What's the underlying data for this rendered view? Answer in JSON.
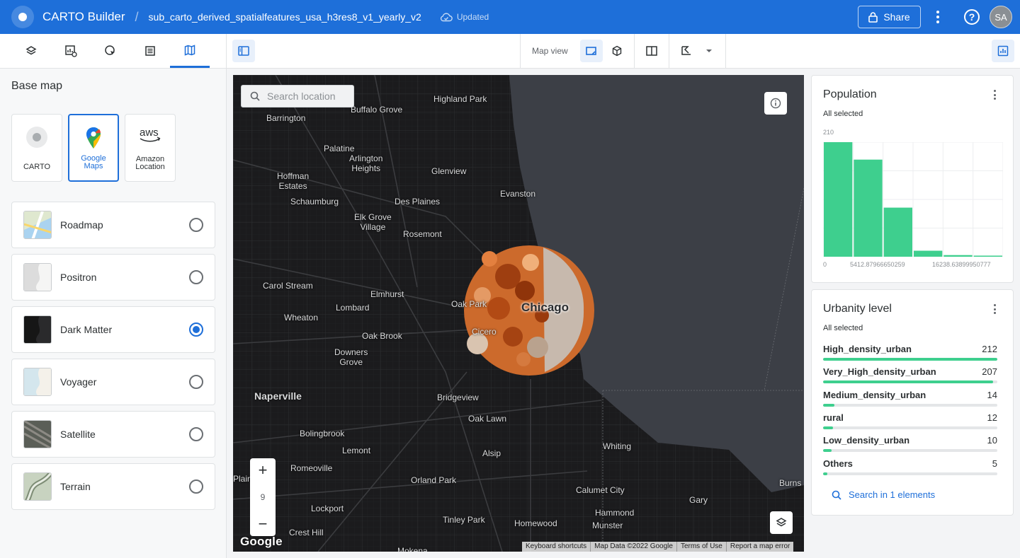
{
  "app": {
    "title": "CARTO Builder",
    "map_name": "sub_carto_derived_spatialfeatures_usa_h3res8_v1_yearly_v2",
    "save_status": "Updated",
    "share_label": "Share",
    "help_label": "?",
    "user_initials": "SA"
  },
  "toolbar": {
    "map_view_label": "Map view"
  },
  "basemap": {
    "title": "Base map",
    "providers": [
      {
        "label": "CARTO",
        "selected": false
      },
      {
        "label": "Google\nMaps",
        "selected": true
      },
      {
        "label": "Amazon\nLocation",
        "selected": false
      }
    ],
    "styles": [
      {
        "name": "Roadmap",
        "selected": false
      },
      {
        "name": "Positron",
        "selected": false
      },
      {
        "name": "Dark Matter",
        "selected": true
      },
      {
        "name": "Voyager",
        "selected": false
      },
      {
        "name": "Satellite",
        "selected": false
      },
      {
        "name": "Terrain",
        "selected": false
      }
    ]
  },
  "map": {
    "search_placeholder": "Search location",
    "zoom_level": "9",
    "google_logo": "Google",
    "attribution": [
      "Keyboard shortcuts",
      "Map Data ©2022 Google",
      "Terms of Use",
      "Report a map error"
    ],
    "labels": {
      "highland_park": "Highland Park",
      "buffalo_grove": "Buffalo Grove",
      "barrington": "Barrington",
      "palatine": "Palatine",
      "arlington_heights": "Arlington\nHeights",
      "glenview": "Glenview",
      "hoffman_estates": "Hoffman\nEstates",
      "evanston": "Evanston",
      "schaumburg": "Schaumburg",
      "des_plaines": "Des Plaines",
      "elk_grove": "Elk Grove\nVillage",
      "rosemont": "Rosemont",
      "carol_stream": "Carol Stream",
      "elmhurst": "Elmhurst",
      "lombard": "Lombard",
      "oak_park": "Oak Park",
      "chicago": "Chicago",
      "wheaton": "Wheaton",
      "cicero": "Cicero",
      "oak_brook": "Oak Brook",
      "downers_grove": "Downers\nGrove",
      "naperville": "Naperville",
      "bridgeview": "Bridgeview",
      "oak_lawn": "Oak Lawn",
      "bolingbrook": "Bolingbrook",
      "lemont": "Lemont",
      "alsip": "Alsip",
      "whiting": "Whiting",
      "romeoville": "Romeoville",
      "plainfield": "Plain",
      "orland_park": "Orland Park",
      "calumet_city": "Calumet City",
      "burns": "Burns",
      "gary": "Gary",
      "lockport": "Lockport",
      "hammond": "Hammond",
      "tinley_park": "Tinley Park",
      "homewood": "Homewood",
      "munster": "Munster",
      "crest_hill": "Crest Hill",
      "mokena": "Mokena"
    }
  },
  "widgets": {
    "population": {
      "title": "Population",
      "subtitle": "All selected",
      "y_max_label": "210",
      "x_labels": [
        "0",
        "5412.87966650259",
        "16238.63899950777"
      ]
    },
    "urbanity": {
      "title": "Urbanity level",
      "subtitle": "All selected",
      "categories": [
        {
          "name": "High_density_urban",
          "value": 212
        },
        {
          "name": "Very_High_density_urban",
          "value": 207
        },
        {
          "name": "Medium_density_urban",
          "value": 14
        },
        {
          "name": "rural",
          "value": 12
        },
        {
          "name": "Low_density_urban",
          "value": 10
        },
        {
          "name": "Others",
          "value": 5
        }
      ],
      "search_label": "Search in 1 elements"
    }
  },
  "chart_data": [
    {
      "type": "bar",
      "title": "Population",
      "categories": [
        "bin1",
        "bin2",
        "bin3",
        "bin4",
        "bin5",
        "bin6"
      ],
      "values": [
        210,
        178,
        90,
        11,
        3,
        2
      ],
      "ylim": [
        0,
        210
      ],
      "xlabel": "",
      "ylabel": "",
      "color": "#3ecf8e"
    }
  ],
  "colors": {
    "brand": "#1e6fd9",
    "accent_green": "#3ecf8e",
    "map_bg": "#1b1b1d",
    "lake": "#3c3f46"
  }
}
